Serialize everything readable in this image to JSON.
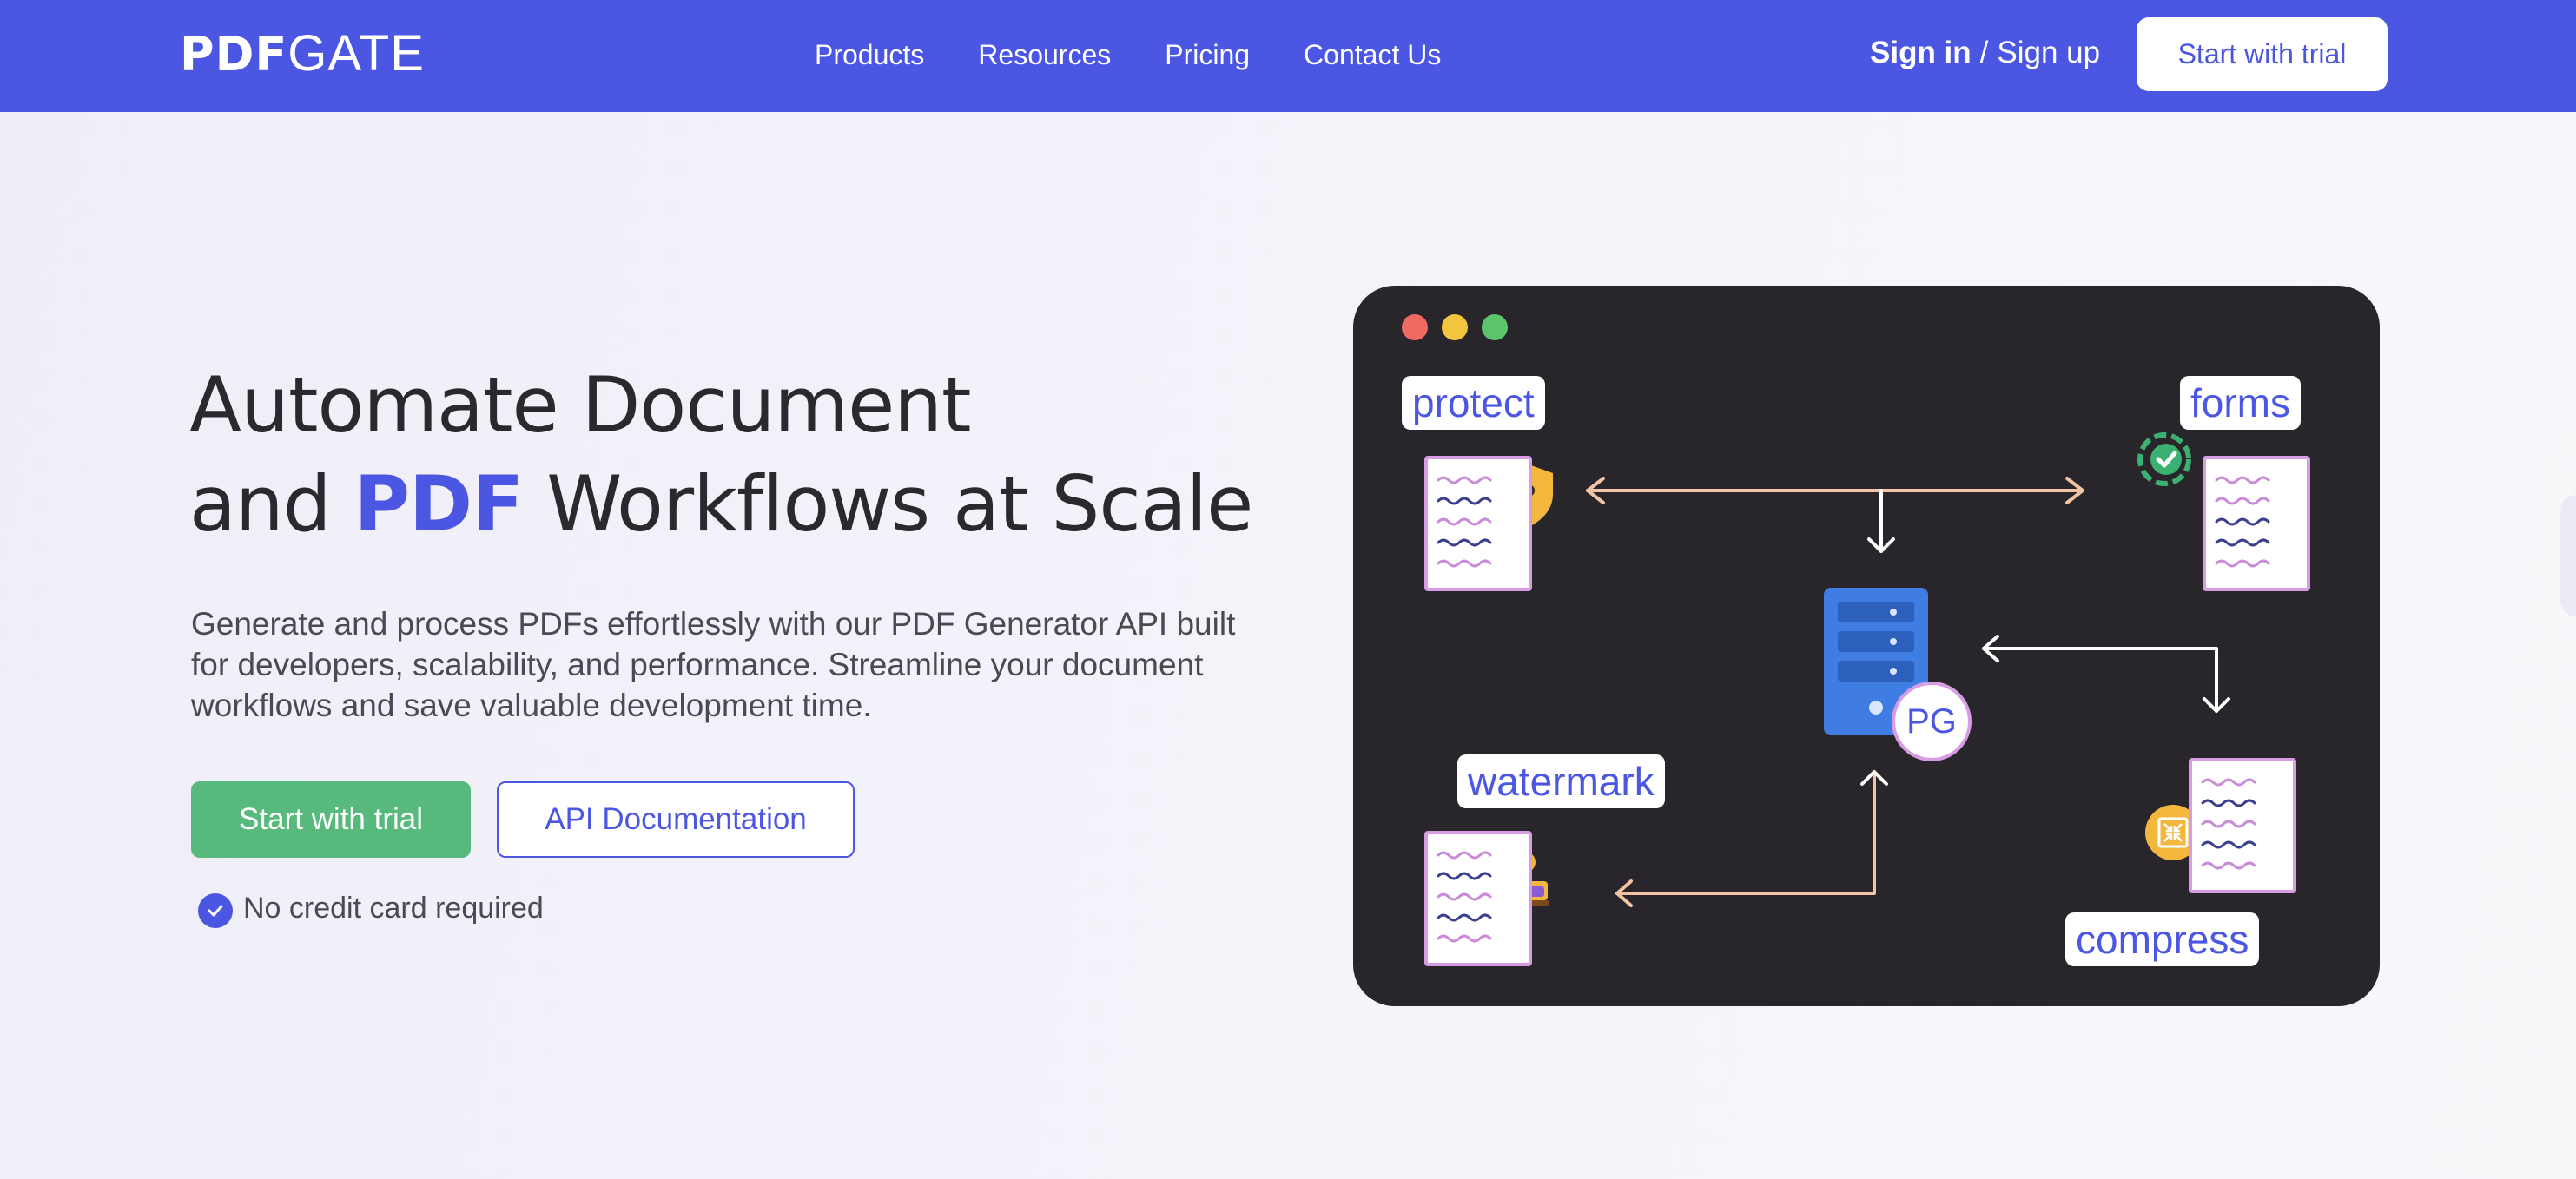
{
  "nav": {
    "logo_bold": "PDF",
    "logo_light": "GATE",
    "links": [
      "Products",
      "Resources",
      "Pricing",
      "Contact Us"
    ],
    "signin": "Sign in",
    "separator": "/",
    "signup": "Sign up",
    "cta": "Start with trial"
  },
  "hero": {
    "title_line1": "Automate Document",
    "title_and": "and",
    "title_accent": "PDF",
    "title_rest": "Workflows at Scale",
    "description": "Generate and process PDFs effortlessly with our PDF Generator API built for developers, scalability, and performance. Streamline your document workflows and save valuable development time.",
    "primary_button": "Start with trial",
    "secondary_button": "API Documentation",
    "note": "No credit card required"
  },
  "illustration": {
    "tags": {
      "protect": "protect",
      "forms": "forms",
      "watermark": "watermark",
      "compress": "compress"
    },
    "server_badge": "PG"
  },
  "colors": {
    "brand": "#4b56e2",
    "cta_green": "#57b97c",
    "window_bg": "#28262b",
    "arrow": "#f2c4a4",
    "doc_border": "#d79ce4"
  }
}
